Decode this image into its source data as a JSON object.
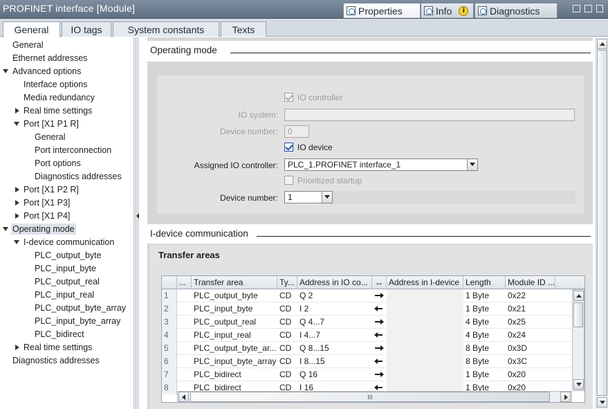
{
  "window": {
    "title": "PROFINET interface [Module]",
    "tabs": [
      {
        "label": "Properties",
        "icon": "properties-icon"
      },
      {
        "label": "Info",
        "icon": "info-icon"
      },
      {
        "label": "Diagnostics",
        "icon": "diagnostics-icon"
      }
    ],
    "info_badge": "i"
  },
  "main_tabs": [
    "General",
    "IO tags",
    "System constants",
    "Texts"
  ],
  "tree": [
    {
      "label": "General"
    },
    {
      "label": "Ethernet addresses"
    },
    {
      "label": "Advanced options"
    },
    {
      "label": "Interface options"
    },
    {
      "label": "Media redundancy"
    },
    {
      "label": "Real time settings"
    },
    {
      "label": "Port [X1 P1 R]"
    },
    {
      "label": "General"
    },
    {
      "label": "Port interconnection"
    },
    {
      "label": "Port options"
    },
    {
      "label": "Diagnostics addresses"
    },
    {
      "label": "Port [X1 P2 R]"
    },
    {
      "label": "Port [X1 P3]"
    },
    {
      "label": "Port [X1 P4]"
    },
    {
      "label": "Operating mode"
    },
    {
      "label": "I-device communication"
    },
    {
      "label": "PLC_output_byte"
    },
    {
      "label": "PLC_input_byte"
    },
    {
      "label": "PLC_output_real"
    },
    {
      "label": "PLC_input_real"
    },
    {
      "label": "PLC_output_byte_array"
    },
    {
      "label": "PLC_input_byte_array"
    },
    {
      "label": "PLC_bidirect"
    },
    {
      "label": "Real time settings"
    },
    {
      "label": "Diagnostics addresses"
    }
  ],
  "operating_mode": {
    "heading": "Operating mode",
    "io_controller_label": "IO controller",
    "io_controller_checked": true,
    "io_system_label": "IO system:",
    "io_system_value": "",
    "device_number_top_label": "Device number:",
    "device_number_top_value": "0",
    "io_device_label": "IO device",
    "io_device_checked": true,
    "assigned_controller_label": "Assigned IO controller:",
    "assigned_controller_value": "PLC_1.PROFINET interface_1",
    "prioritized_startup_label": "Prioritized startup",
    "prioritized_startup_checked": false,
    "device_number_label": "Device number:",
    "device_number_value": "1"
  },
  "idevice": {
    "heading": "I-device communication",
    "subheading": "Transfer areas",
    "columns": [
      "...",
      "Transfer area",
      "Ty...",
      "Address in IO co...",
      "↔",
      "Address in I-device",
      "Length",
      "Module ID ..."
    ],
    "rows": [
      {
        "num": "1",
        "name": "PLC_output_byte",
        "type": "CD",
        "io_addr": "Q 2",
        "dir": "right",
        "dev_addr": "",
        "length": "1 Byte",
        "module_id": "0x22"
      },
      {
        "num": "2",
        "name": "PLC_input_byte",
        "type": "CD",
        "io_addr": "I 2",
        "dir": "left",
        "dev_addr": "",
        "length": "1 Byte",
        "module_id": "0x21"
      },
      {
        "num": "3",
        "name": "PLC_output_real",
        "type": "CD",
        "io_addr": "Q 4...7",
        "dir": "right",
        "dev_addr": "",
        "length": "4 Byte",
        "module_id": "0x25"
      },
      {
        "num": "4",
        "name": "PLC_input_real",
        "type": "CD",
        "io_addr": "I 4...7",
        "dir": "left",
        "dev_addr": "",
        "length": "4 Byte",
        "module_id": "0x24"
      },
      {
        "num": "5",
        "name": "PLC_output_byte_ar...",
        "type": "CD",
        "io_addr": "Q 8...15",
        "dir": "right",
        "dev_addr": "",
        "length": "8 Byte",
        "module_id": "0x3D"
      },
      {
        "num": "6",
        "name": "PLC_input_byte_array",
        "type": "CD",
        "io_addr": "I 8...15",
        "dir": "left",
        "dev_addr": "",
        "length": "8 Byte",
        "module_id": "0x3C"
      },
      {
        "num": "7",
        "name": "PLC_bidirect",
        "type": "CD",
        "io_addr": "Q 16",
        "dir": "right",
        "dev_addr": "",
        "length": "1 Byte",
        "module_id": "0x20"
      },
      {
        "num": "8",
        "name": "PLC_bidirect",
        "type": "CD",
        "io_addr": "I 16",
        "dir": "left",
        "dev_addr": "",
        "length": "1 Byte",
        "module_id": "0x20"
      }
    ],
    "hscroll_grip": "III"
  }
}
